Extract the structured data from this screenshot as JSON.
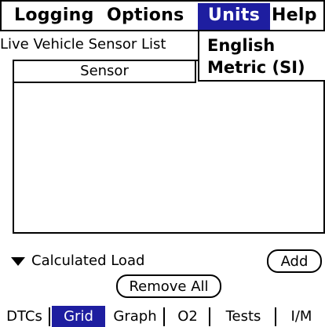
{
  "menubar": {
    "items": [
      "Logging",
      "Options",
      "Units",
      "Help"
    ],
    "active": "Units"
  },
  "units_menu": {
    "options": [
      "English",
      "Metric (SI)"
    ]
  },
  "list": {
    "title": "Live Vehicle Sensor List",
    "header": "Sensor"
  },
  "controls": {
    "selector_value": "Calculated Load",
    "add_label": "Add",
    "remove_all_label": "Remove All"
  },
  "tabs": {
    "items": [
      "DTCs",
      "Grid",
      "Graph",
      "O2",
      "Tests",
      "I/M"
    ],
    "selected": "Grid"
  },
  "colors": {
    "accent": "#1e1ea0"
  }
}
